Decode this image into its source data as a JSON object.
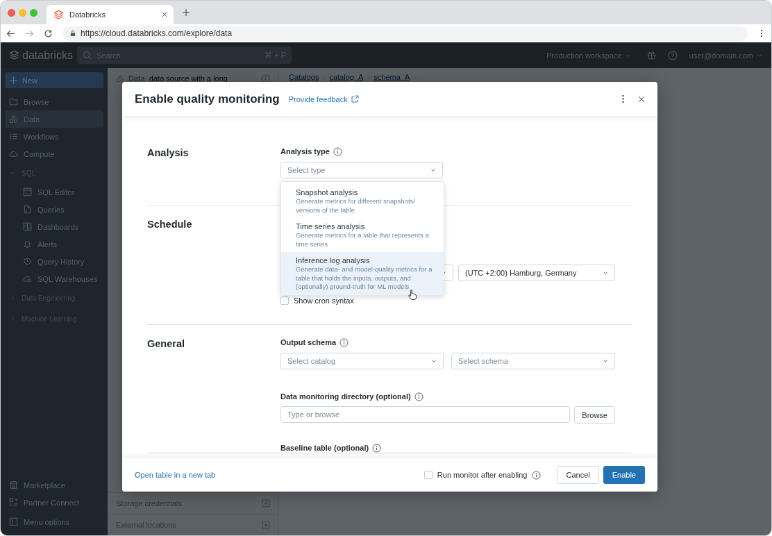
{
  "browser": {
    "tab": {
      "title": "Databricks",
      "selected": true
    },
    "url": "https://cloud.databricks.com/explore/data"
  },
  "topbar": {
    "logo": "databricks",
    "search": {
      "placeholder": "Search",
      "shortcut": "⌘ + P"
    },
    "workspace": "Production workspace",
    "user": "user@domain.com"
  },
  "sidebar": {
    "new_button": "New",
    "items": [
      {
        "kind": "link",
        "label": "Browse",
        "selected": false
      },
      {
        "kind": "link",
        "label": "Data",
        "selected": true
      },
      {
        "kind": "link",
        "label": "Workflows",
        "selected": false
      },
      {
        "kind": "link",
        "label": "Compute",
        "selected": false
      },
      {
        "kind": "group",
        "label": "SQL",
        "expanded": true,
        "children": [
          {
            "kind": "link",
            "label": "SQL Editor",
            "selected": false
          },
          {
            "kind": "link",
            "label": "Queries",
            "selected": false
          },
          {
            "kind": "link",
            "label": "Dashboards",
            "selected": false
          },
          {
            "kind": "link",
            "label": "Alerts",
            "selected": false
          },
          {
            "kind": "link",
            "label": "Query History",
            "selected": false
          },
          {
            "kind": "link",
            "label": "SQL Warehouses",
            "selected": false
          }
        ]
      },
      {
        "kind": "group",
        "label": "Data Engineering",
        "expanded": false
      },
      {
        "kind": "group",
        "label": "Machine Learning",
        "expanded": false
      }
    ],
    "bottom_items": [
      {
        "label": "Marketplace"
      },
      {
        "label": "Partner Connect"
      },
      {
        "label": "Menu options"
      }
    ]
  },
  "data_panel": {
    "title": "Data",
    "subtitle": "data source with a long",
    "rows": [
      {
        "label": "Storage credentials"
      },
      {
        "label": "External locations"
      }
    ]
  },
  "content": {
    "breadcrumb": [
      "Catalogs",
      "catalog_A",
      "schema_A"
    ]
  },
  "modal": {
    "title": "Enable quality monitoring",
    "feedback_link": "Provide feedback",
    "sections": [
      {
        "heading": "Analysis",
        "fields": [
          {
            "kind": "select",
            "label": "Analysis type",
            "info": true,
            "placeholder": "Select type",
            "open": true,
            "options": [
              {
                "title": "Snapshot analysis",
                "description": "Generate metrics for different snapshots/ versions of the table",
                "selected": false
              },
              {
                "title": "Time series analysis",
                "description": "Generate metrics for a table that represents a time series",
                "selected": false
              },
              {
                "title": "Inference log analysis",
                "description": "Generate data- and model-quality metrics for a table that holds the inputs, outputs, and (optionally) ground-truth for ML models",
                "selected": true
              }
            ]
          }
        ]
      },
      {
        "heading": "Schedule",
        "fields": [
          {
            "kind": "select_row",
            "selects": [
              {
                "kind": "select"
              },
              {
                "kind": "select",
                "value": "(UTC +2:00) Hamburg, Germany"
              }
            ]
          },
          {
            "kind": "checkbox",
            "label": "Show cron syntax",
            "checked": false
          }
        ]
      },
      {
        "heading": "General",
        "fields": [
          {
            "kind": "select_row",
            "label": "Output schema",
            "info": true,
            "selects": [
              {
                "kind": "select",
                "placeholder": "Select catalog"
              },
              {
                "kind": "select",
                "placeholder": "Select schema"
              }
            ]
          },
          {
            "kind": "input",
            "label": "Data monitoring directory (optional)",
            "info": true,
            "placeholder": "Type or browse",
            "button": "Browse"
          },
          {
            "kind": "label",
            "label": "Baseline table (optional)",
            "info": true
          }
        ]
      }
    ],
    "footer": {
      "link": "Open table in a new tab",
      "run_after": {
        "label": "Run monitor after enabling",
        "checked": false
      },
      "cancel": "Cancel",
      "confirm": "Enable"
    }
  }
}
